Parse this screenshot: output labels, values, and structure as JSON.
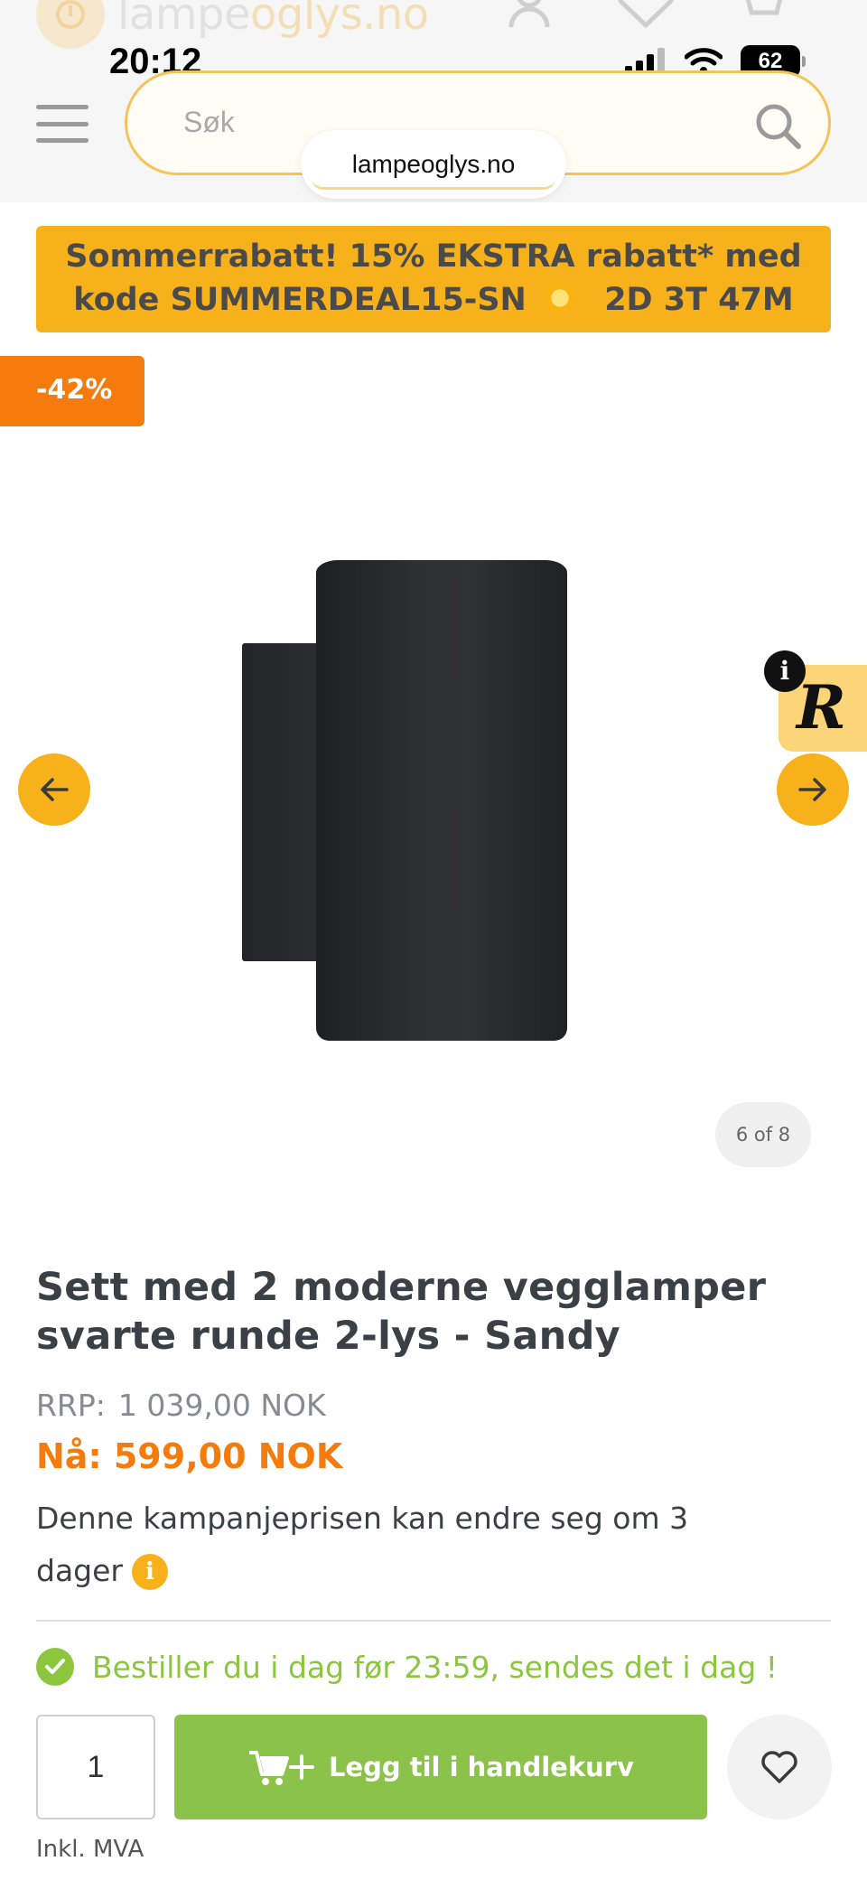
{
  "status_bar": {
    "time": "20:12",
    "battery": "62"
  },
  "header": {
    "logo": {
      "name": "lampe",
      "accent": "oglys",
      "tld": ".no"
    },
    "search_placeholder": "Søk",
    "url": "lampeoglys.no"
  },
  "promo": {
    "line1": "Sommerrabatt! 15% EKSTRA rabatt* med",
    "line2_code": "kode SUMMERDEAL15-SN",
    "countdown": "2D 3T 47M"
  },
  "product": {
    "discount_badge": "-42%",
    "gallery_counter": "6 of 8",
    "title": "Sett med 2 moderne vegglamper svarte runde 2-lys - Sandy",
    "rrp_label": "RRP:",
    "rrp_price": "1 039,00 NOK",
    "now_price": "Nå: 599,00 NOK",
    "campaign_text": "Denne kampanjeprisen kan endre seg om 3 dager",
    "shipping_text": "Bestiller du i dag før 23:59, sendes det i dag !",
    "quantity": "1",
    "add_to_cart": "Legg til i handlekurv",
    "vat_note": "Inkl. MVA"
  },
  "colors": {
    "accent": "#f7b11b",
    "discount": "#f57c0c",
    "success": "#8bc34a"
  }
}
